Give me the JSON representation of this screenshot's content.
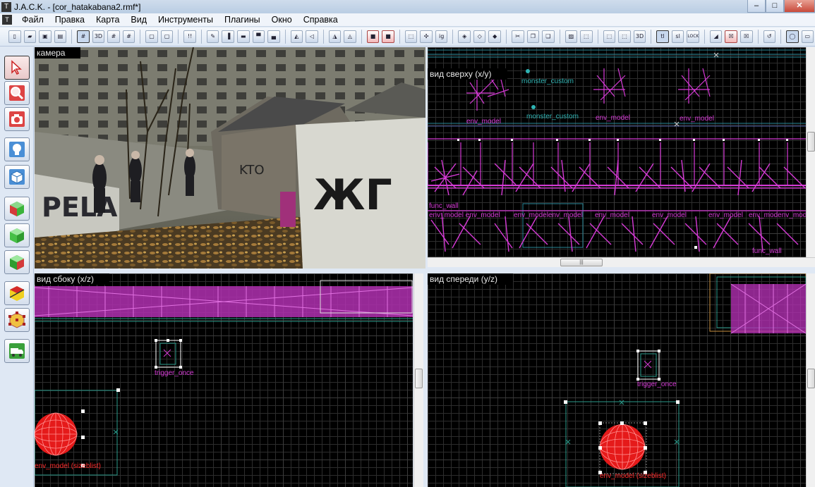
{
  "window": {
    "title": "J.A.C.K. - [cor_hatakabana2.rmf*]",
    "minimize": "–",
    "maximize": "□",
    "close": "✕"
  },
  "menu": {
    "items": [
      "Файл",
      "Правка",
      "Карта",
      "Вид",
      "Инструменты",
      "Плагины",
      "Окно",
      "Справка"
    ]
  },
  "toolbar": {
    "icons": [
      "new-icon",
      "open-icon",
      "save-icon",
      "save-as-icon",
      "grid-icon",
      "3d-grid-icon",
      "small-grid-icon",
      "large-grid-icon",
      "group-icon",
      "ungroup-icon",
      "carve-icon",
      "texture-lock-icon",
      "edit-icon",
      "align-left-icon",
      "align-center-icon",
      "align-top-icon",
      "align-bottom-icon",
      "flip-h-icon",
      "flip-v-icon",
      "rotate-left-icon",
      "rotate-right-icon",
      "hide-icon",
      "show-icon",
      "selection-icon",
      "entity-icon",
      "ignore-group-icon",
      "brush-icon",
      "clip-icon",
      "vertex-icon",
      "cut-icon",
      "copy-icon",
      "paste-icon",
      "hollow-icon",
      "select-all-icon",
      "zoom-in-icon",
      "zoom-out-icon",
      "zoom-3d-icon",
      "texture-lock-tl-icon",
      "scale-lock-icon",
      "lock-icon",
      "palette-icon",
      "toggle-red-icon",
      "toggle-green-icon",
      "undo-icon",
      "magnify-icon",
      "panel-icon"
    ],
    "text_buttons": {
      "ig": "ig",
      "tl": "tl",
      "sl": "sl",
      "lock": "LOCK"
    }
  },
  "tools": [
    "selection-tool",
    "magnify-tool",
    "camera-tool",
    "entity-tool",
    "block-tool",
    "texture-tool",
    "apply-texture-tool",
    "decal-tool",
    "clip-tool",
    "vertex-tool",
    "path-tool"
  ],
  "viewports": {
    "camera": {
      "label": "камера"
    },
    "top": {
      "label": "вид сверху  (x/y)",
      "entities": [
        {
          "name": "monster_custom",
          "color": "cyan"
        },
        {
          "name": "monster_custom",
          "color": "cyan"
        },
        {
          "name": "env_model",
          "color": "magenta"
        },
        {
          "name": "env_model",
          "color": "magenta"
        },
        {
          "name": "env_model",
          "color": "magenta"
        },
        {
          "name": "func_wall",
          "color": "magenta"
        },
        {
          "name": "env_model env_model",
          "color": "magenta"
        },
        {
          "name": "env_modelenv_model",
          "color": "magenta"
        },
        {
          "name": "env_model",
          "color": "magenta"
        },
        {
          "name": "env_model",
          "color": "magenta"
        },
        {
          "name": "env_model",
          "color": "magenta"
        },
        {
          "name": "env_modenv_mod",
          "color": "magenta"
        },
        {
          "name": "func_wall",
          "color": "magenta"
        }
      ]
    },
    "side": {
      "label": "вид сбоку  (x/z)",
      "entities": [
        {
          "name": "trigger_once",
          "color": "magenta"
        },
        {
          "name": "env_model (sizeblist)",
          "color": "red"
        }
      ]
    },
    "front": {
      "label": "вид спереди  (y/z)",
      "entities": [
        {
          "name": "trigger_once",
          "color": "magenta"
        },
        {
          "name": "env_model (sizeblist)",
          "color": "red"
        }
      ]
    }
  },
  "scrollbar": {
    "grip": "|||"
  },
  "colors": {
    "magenta": "#d63ad6",
    "cyan": "#2fb3b3",
    "red": "#ff2020",
    "teal_box": "#2a9a8a",
    "grid": "#2d2d2d"
  }
}
